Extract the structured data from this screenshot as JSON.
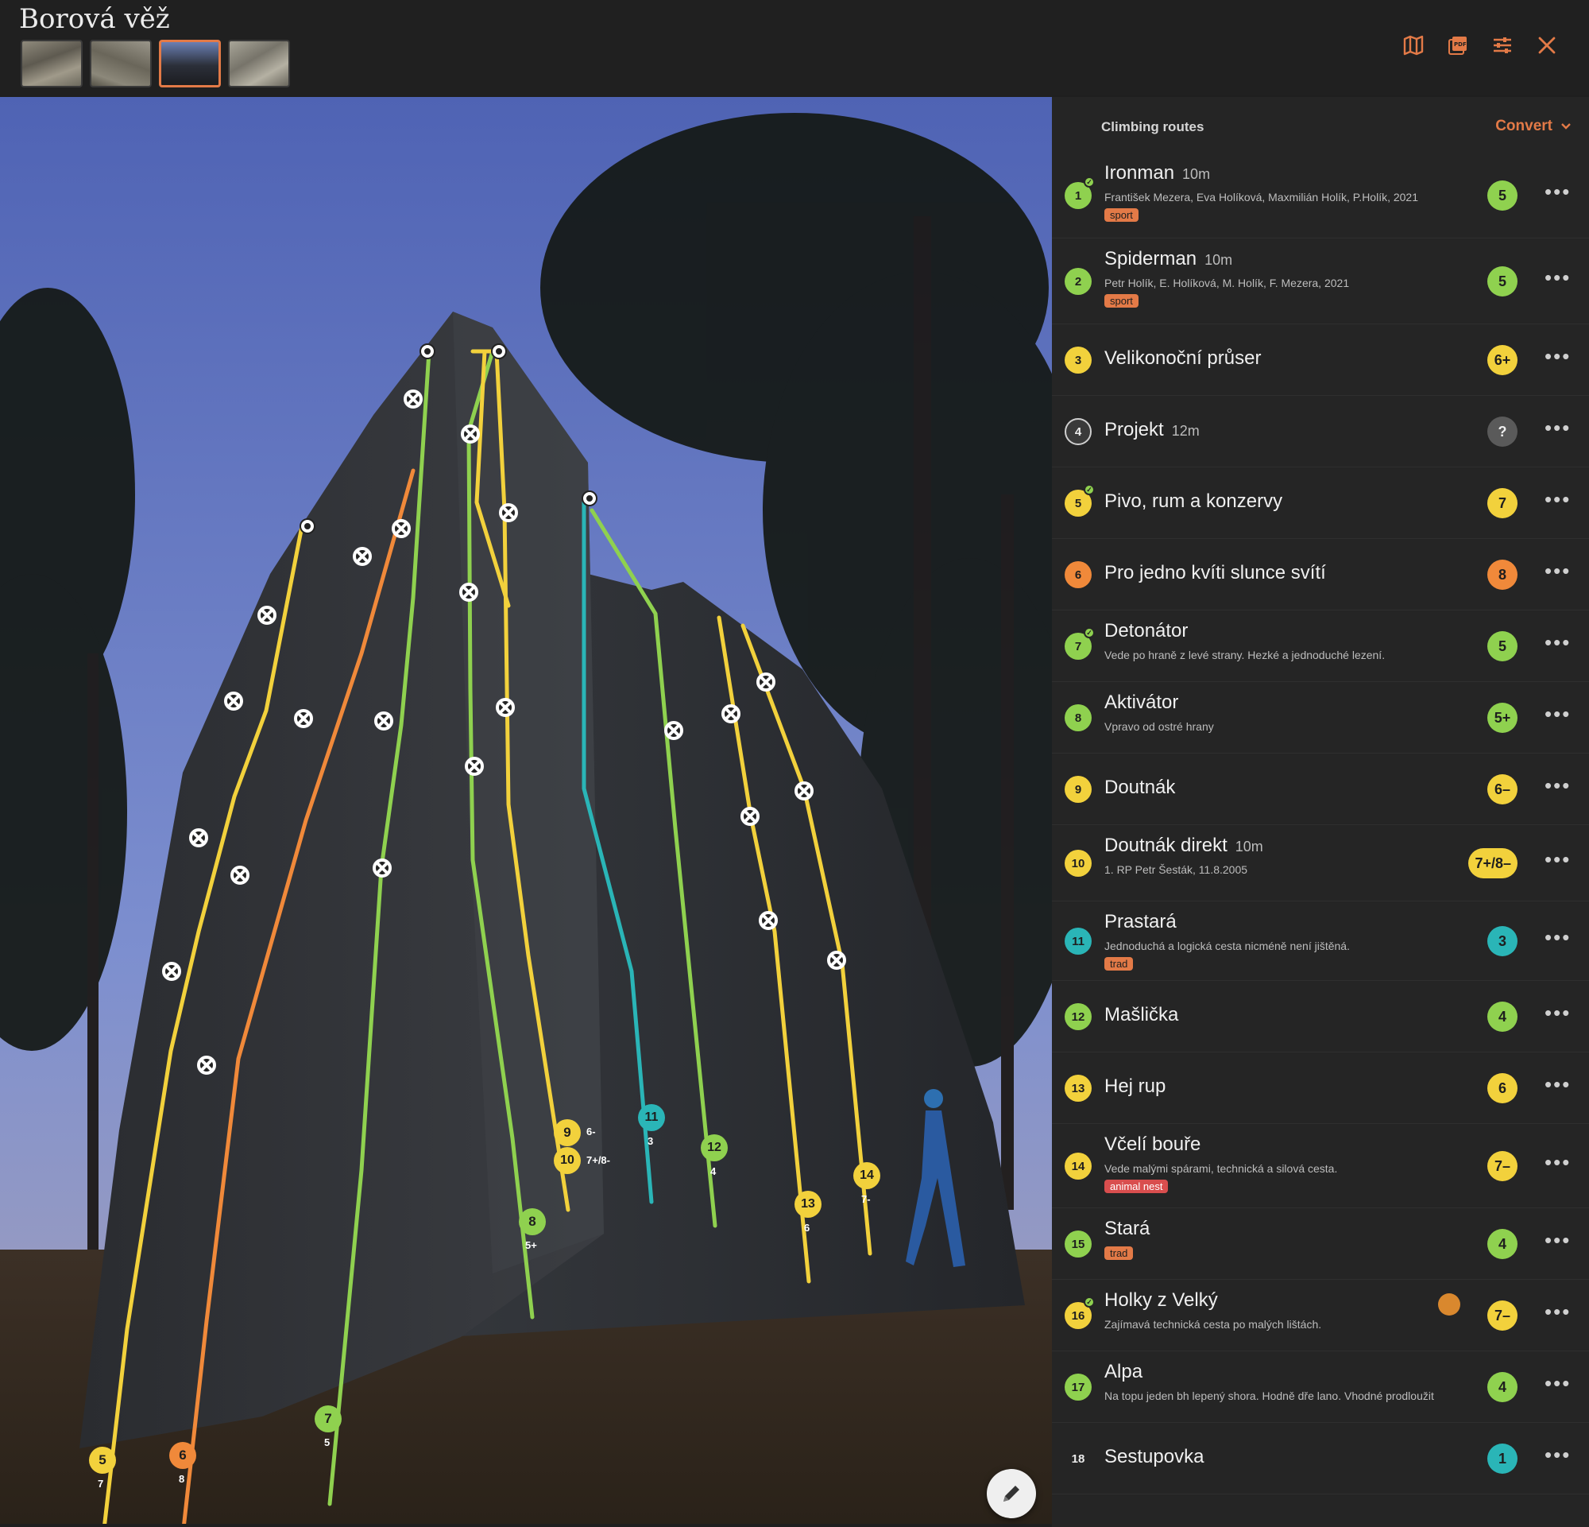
{
  "title": "Borová věž",
  "thumbnails": [
    "photo-1",
    "photo-2",
    "photo-3",
    "photo-4"
  ],
  "active_thumbnail": 2,
  "header_icons": [
    "map-icon",
    "pdf-icon",
    "settings-sliders-icon",
    "close-icon"
  ],
  "sidebar": {
    "heading": "Climbing routes",
    "convert_label": "Convert"
  },
  "colors": {
    "accent": "#e37a47",
    "green": "#8fd14f",
    "yellow": "#f2d13c",
    "orange": "#f0893a",
    "teal": "#2ab5b7"
  },
  "routes": [
    {
      "num": "1",
      "color": "green",
      "name": "Ironman",
      "length": "10m",
      "desc": "František Mezera, Eva Holíková, Maxmilián Holík, P.Holík, 2021",
      "tag": "sport",
      "grade": "5",
      "tick": true
    },
    {
      "num": "2",
      "color": "green",
      "name": "Spiderman",
      "length": "10m",
      "desc": "Petr Holík, E. Holíková, M. Holík, F. Mezera, 2021",
      "tag": "sport",
      "grade": "5",
      "tick": false
    },
    {
      "num": "3",
      "color": "yellow",
      "name": "Velikonoční průser",
      "length": "",
      "desc": "",
      "tag": "",
      "grade": "6+",
      "tick": false
    },
    {
      "num": "4",
      "color": "gray",
      "name": "Projekt",
      "length": "12m",
      "desc": "",
      "tag": "",
      "grade": "?",
      "tick": false
    },
    {
      "num": "5",
      "color": "yellow",
      "name": "Pivo, rum a konzervy",
      "length": "",
      "desc": "",
      "tag": "",
      "grade": "7",
      "tick": true
    },
    {
      "num": "6",
      "color": "orange",
      "name": "Pro jedno kvíti slunce svítí",
      "length": "",
      "desc": "",
      "tag": "",
      "grade": "8",
      "tick": false
    },
    {
      "num": "7",
      "color": "green",
      "name": "Detonátor",
      "length": "",
      "desc": "Vede po hraně z levé strany. Hezké a jednoduché lezení.",
      "tag": "",
      "grade": "5",
      "tick": true
    },
    {
      "num": "8",
      "color": "green",
      "name": "Aktivátor",
      "length": "",
      "desc": "Vpravo od ostré hrany",
      "tag": "",
      "grade": "5+",
      "tick": false
    },
    {
      "num": "9",
      "color": "yellow",
      "name": "Doutnák",
      "length": "",
      "desc": "",
      "tag": "",
      "grade": "6–",
      "tick": false
    },
    {
      "num": "10",
      "color": "yellow",
      "name": "Doutnák direkt",
      "length": "10m",
      "desc": "1. RP Petr Šesták, 11.8.2005",
      "tag": "",
      "grade": "7+/8–",
      "tick": false
    },
    {
      "num": "11",
      "color": "teal",
      "name": "Prastará",
      "length": "",
      "desc": "Jednoduchá a logická cesta nicméně není jištěná.",
      "tag": "trad",
      "grade": "3",
      "tick": false
    },
    {
      "num": "12",
      "color": "green",
      "name": "Mašlička",
      "length": "",
      "desc": "",
      "tag": "",
      "grade": "4",
      "tick": false
    },
    {
      "num": "13",
      "color": "yellow",
      "name": "Hej rup",
      "length": "",
      "desc": "",
      "tag": "",
      "grade": "6",
      "tick": false
    },
    {
      "num": "14",
      "color": "yellow",
      "name": "Včelí bouře",
      "length": "",
      "desc": "Vede malými spárami, technická a silová cesta.",
      "tag": "animal nest",
      "grade": "7–",
      "tick": false
    },
    {
      "num": "15",
      "color": "green",
      "name": "Stará",
      "length": "",
      "desc": "",
      "tag": "trad",
      "grade": "4",
      "tick": false
    },
    {
      "num": "16",
      "color": "yellow",
      "name": "Holky z Velký",
      "length": "",
      "desc": "Zajímavá technická cesta po malých lištách.",
      "tag": "",
      "grade": "7–",
      "tick": true,
      "avatar": true
    },
    {
      "num": "17",
      "color": "green",
      "name": "Alpa",
      "length": "",
      "desc": "Na topu jeden bh lepený shora. Hodně dře lano. Vhodné prodloužit",
      "tag": "",
      "grade": "4",
      "tick": false
    },
    {
      "num": "18",
      "color": "none",
      "name": "Sestupovka",
      "length": "",
      "desc": "",
      "tag": "",
      "grade": "1",
      "grade_color": "teal",
      "tick": false
    }
  ],
  "topo_labels": [
    {
      "num": "5",
      "grade": "7",
      "color": "yellow"
    },
    {
      "num": "6",
      "grade": "8",
      "color": "orange"
    },
    {
      "num": "7",
      "grade": "5",
      "color": "green"
    },
    {
      "num": "8",
      "grade": "5+",
      "color": "green"
    },
    {
      "num": "9",
      "grade": "6-",
      "color": "yellow"
    },
    {
      "num": "10",
      "grade": "7+/8-",
      "color": "yellow"
    },
    {
      "num": "11",
      "grade": "3",
      "color": "teal"
    },
    {
      "num": "12",
      "grade": "4",
      "color": "green"
    },
    {
      "num": "13",
      "grade": "6",
      "color": "yellow"
    },
    {
      "num": "14",
      "grade": "7-",
      "color": "yellow"
    }
  ]
}
